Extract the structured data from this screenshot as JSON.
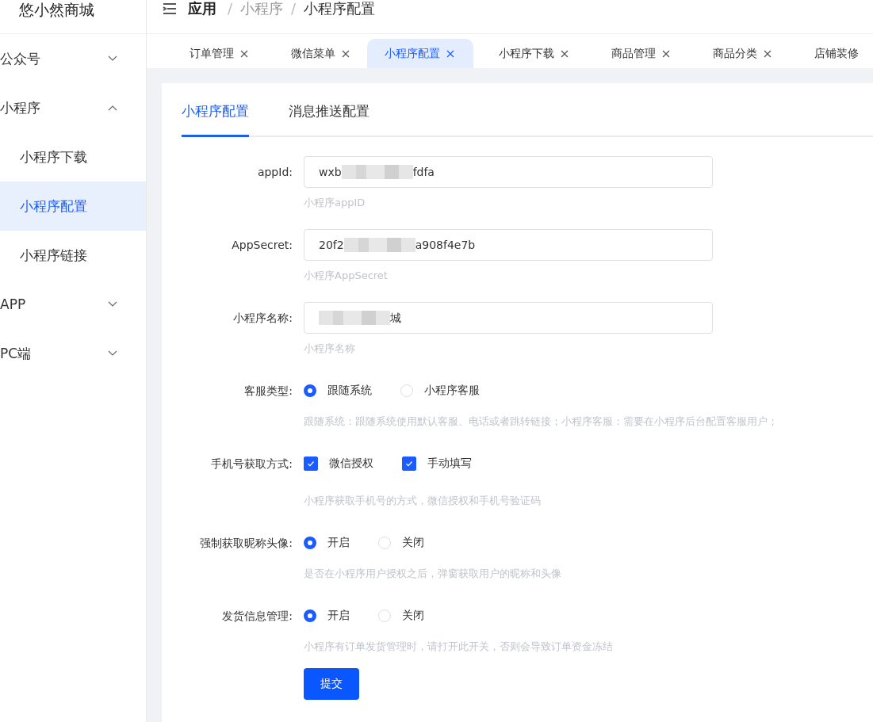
{
  "sidebar": {
    "title": "悠小然商城",
    "items": [
      {
        "label": "公众号",
        "kind": "group",
        "expanded": false,
        "selected": false
      },
      {
        "label": "小程序",
        "kind": "group",
        "expanded": true,
        "selected": false
      },
      {
        "label": "小程序下载",
        "kind": "sub",
        "selected": false
      },
      {
        "label": "小程序配置",
        "kind": "sub",
        "selected": true
      },
      {
        "label": "小程序链接",
        "kind": "sub",
        "selected": false
      },
      {
        "label": "APP",
        "kind": "group",
        "expanded": false,
        "selected": false
      },
      {
        "label": "PC端",
        "kind": "group",
        "expanded": false,
        "selected": false
      }
    ]
  },
  "breadcrumb": [
    {
      "text": "应用"
    },
    {
      "separator": "/",
      "text": "小程序"
    },
    {
      "separator": "/",
      "text": "小程序配置"
    }
  ],
  "page_tabs": [
    {
      "label": "订单管理",
      "selected": false,
      "closable": true
    },
    {
      "label": "微信菜单",
      "selected": false,
      "closable": true
    },
    {
      "label": "小程序配置",
      "selected": true,
      "closable": true
    },
    {
      "label": "小程序下载",
      "selected": false,
      "closable": true
    },
    {
      "label": "商品管理",
      "selected": false,
      "closable": true
    },
    {
      "label": "商品分类",
      "selected": false,
      "closable": true
    },
    {
      "label": "店铺装修",
      "selected": false,
      "closable": false
    }
  ],
  "content_tabs": [
    {
      "label": "小程序配置",
      "selected": true
    },
    {
      "label": "消息推送配置",
      "selected": false
    }
  ],
  "form": [
    {
      "kind": "input",
      "label": "appId:",
      "prefix": "wxb",
      "suffix": "fdfa",
      "help": "小程序appID"
    },
    {
      "kind": "input",
      "label": "AppSecret:",
      "prefix": "20f2",
      "suffix": "a908f4e7b",
      "help": "小程序AppSecret"
    },
    {
      "kind": "input",
      "label": "小程序名称:",
      "suffix": "城",
      "help": "小程序名称"
    },
    {
      "kind": "radio",
      "label": "客服类型:",
      "options": [
        {
          "label": "跟随系统",
          "selected": true
        },
        {
          "label": "小程序客服",
          "selected": false
        }
      ],
      "help": "跟随系统：跟随系统使用默认客服、电话或者跳转链接；小程序客服：需要在小程序后台配置客服用户；"
    },
    {
      "kind": "checkbox",
      "label": "手机号获取方式:",
      "options": [
        {
          "label": "微信授权",
          "checked": true
        },
        {
          "label": "手动填写",
          "checked": true
        }
      ],
      "help": "小程序获取手机号的方式，微信授权和手机号验证码"
    },
    {
      "kind": "radio",
      "label": "强制获取昵称头像:",
      "options": [
        {
          "label": "开启",
          "selected": true
        },
        {
          "label": "关闭",
          "selected": false
        }
      ],
      "help": "是否在小程序用户授权之后，弹窗获取用户的昵称和头像"
    },
    {
      "kind": "radio",
      "label": "发货信息管理:",
      "options": [
        {
          "label": "开启",
          "selected": true
        },
        {
          "label": "关闭",
          "selected": false
        }
      ],
      "help": "小程序有订单发货管理时，请打开此开关，否则会导致订单资金冻结"
    }
  ],
  "submit": "提交"
}
